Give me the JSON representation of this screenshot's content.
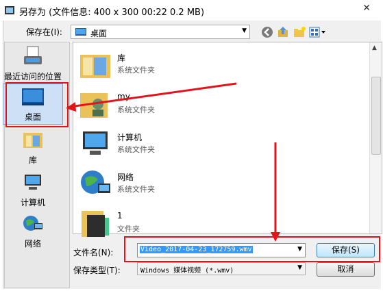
{
  "window": {
    "title": "另存为 (文件信息: 400 x 300    00:22    0.2 MB)",
    "close_glyph": "✕"
  },
  "header": {
    "save_in_label": "保存在(I):",
    "save_in_value": "桌面"
  },
  "places": {
    "items": [
      {
        "label": "最近访问的位置",
        "icon": "recent-places-icon"
      },
      {
        "label": "桌面",
        "icon": "desktop-icon"
      },
      {
        "label": "库",
        "icon": "library-icon"
      },
      {
        "label": "计算机",
        "icon": "computer-icon"
      },
      {
        "label": "网络",
        "icon": "network-icon"
      }
    ],
    "selected": "桌面"
  },
  "files": [
    {
      "name": "库",
      "type": "系统文件夹"
    },
    {
      "name": "my",
      "type": "系统文件夹"
    },
    {
      "name": "计算机",
      "type": "系统文件夹"
    },
    {
      "name": "网络",
      "type": "系统文件夹"
    },
    {
      "name": "1",
      "type": "文件夹"
    }
  ],
  "footer": {
    "filename_label": "文件名(N):",
    "filename_value": "Video_2017-04-23_172759.wmv",
    "filetype_label": "保存类型(T):",
    "filetype_value": "Windows 媒体视频 (*.wmv)",
    "save_button": "保存(S)",
    "cancel_button": "取消"
  },
  "colors": {
    "annotation_red": "#e2141b",
    "selection_blue": "#3399ff"
  }
}
